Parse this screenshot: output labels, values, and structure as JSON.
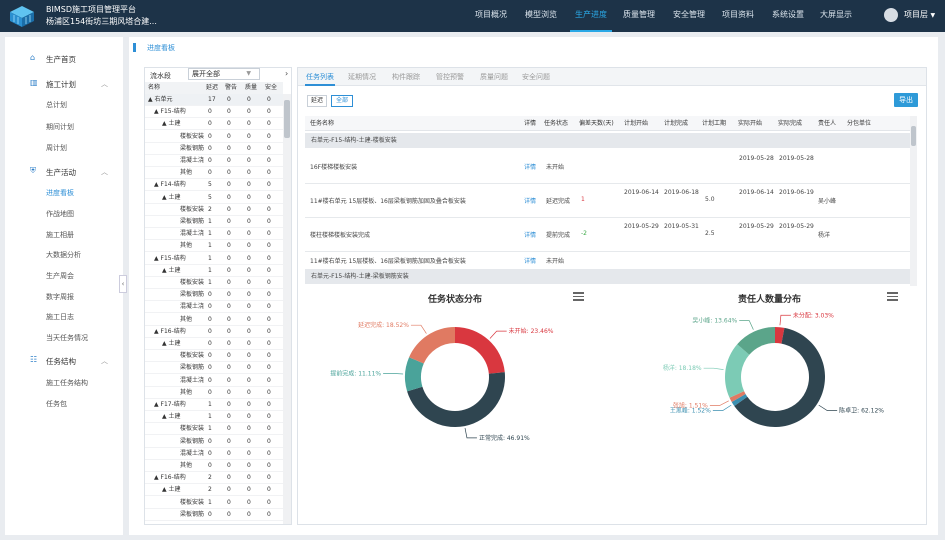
{
  "header": {
    "brand_line1": "BIMSD施工项目管理平台",
    "brand_line2": "杨浦区154街坊三期风塔合建...",
    "nav": [
      "项目概况",
      "模型浏览",
      "生产进度",
      "质量管理",
      "安全管理",
      "项目资料",
      "系统设置",
      "大屏显示"
    ],
    "active_nav": "生产进度",
    "user": "项目层"
  },
  "sidebar": {
    "home": "生产首页",
    "plan": {
      "label": "施工计划",
      "items": [
        "总计划",
        "期间计划",
        "周计划"
      ]
    },
    "activity": {
      "label": "生产活动",
      "items": [
        "进度看板",
        "作战地图",
        "施工相册",
        "大数据分析",
        "生产周会",
        "数字周报",
        "施工日志",
        "当天任务情况"
      ]
    },
    "structure": {
      "label": "任务结构",
      "items": [
        "施工任务结构",
        "任务包"
      ]
    },
    "active_item": "进度看板"
  },
  "breadcrumb": "进度看板",
  "tree_panel": {
    "filter_label": "流水段",
    "filter_value": "展开全部",
    "columns": [
      "名称",
      "延迟",
      "警告",
      "质量",
      "安全"
    ],
    "rows": [
      {
        "name": "▲ 右单元",
        "v": [
          "17",
          "0",
          "0",
          "0"
        ]
      },
      {
        "name": "▲ F15-结构",
        "v": [
          "0",
          "0",
          "0",
          "0"
        ]
      },
      {
        "name": "▲ 土建",
        "v": [
          "0",
          "0",
          "0",
          "0"
        ]
      },
      {
        "name": "楼板安装",
        "v": [
          "0",
          "0",
          "0",
          "0"
        ]
      },
      {
        "name": "梁板钢筋",
        "v": [
          "0",
          "0",
          "0",
          "0"
        ]
      },
      {
        "name": "混凝土浇",
        "v": [
          "0",
          "0",
          "0",
          "0"
        ]
      },
      {
        "name": "其他",
        "v": [
          "0",
          "0",
          "0",
          "0"
        ]
      },
      {
        "name": "▲ F14-结构",
        "v": [
          "5",
          "0",
          "0",
          "0"
        ]
      },
      {
        "name": "▲ 土建",
        "v": [
          "5",
          "0",
          "0",
          "0"
        ]
      },
      {
        "name": "楼板安装",
        "v": [
          "2",
          "0",
          "0",
          "0"
        ]
      },
      {
        "name": "梁板钢筋",
        "v": [
          "1",
          "0",
          "0",
          "0"
        ]
      },
      {
        "name": "混凝土浇",
        "v": [
          "1",
          "0",
          "0",
          "0"
        ]
      },
      {
        "name": "其他",
        "v": [
          "1",
          "0",
          "0",
          "0"
        ]
      },
      {
        "name": "▲ F15-结构",
        "v": [
          "1",
          "0",
          "0",
          "0"
        ]
      },
      {
        "name": "▲ 土建",
        "v": [
          "1",
          "0",
          "0",
          "0"
        ]
      },
      {
        "name": "楼板安装",
        "v": [
          "1",
          "0",
          "0",
          "0"
        ]
      },
      {
        "name": "梁板钢筋",
        "v": [
          "0",
          "0",
          "0",
          "0"
        ]
      },
      {
        "name": "混凝土浇",
        "v": [
          "0",
          "0",
          "0",
          "0"
        ]
      },
      {
        "name": "其他",
        "v": [
          "0",
          "0",
          "0",
          "0"
        ]
      },
      {
        "name": "▲ F16-结构",
        "v": [
          "0",
          "0",
          "0",
          "0"
        ]
      },
      {
        "name": "▲ 土建",
        "v": [
          "0",
          "0",
          "0",
          "0"
        ]
      },
      {
        "name": "楼板安装",
        "v": [
          "0",
          "0",
          "0",
          "0"
        ]
      },
      {
        "name": "梁板钢筋",
        "v": [
          "0",
          "0",
          "0",
          "0"
        ]
      },
      {
        "name": "混凝土浇",
        "v": [
          "0",
          "0",
          "0",
          "0"
        ]
      },
      {
        "name": "其他",
        "v": [
          "0",
          "0",
          "0",
          "0"
        ]
      },
      {
        "name": "▲ F17-结构",
        "v": [
          "1",
          "0",
          "0",
          "0"
        ]
      },
      {
        "name": "▲ 土建",
        "v": [
          "1",
          "0",
          "0",
          "0"
        ]
      },
      {
        "name": "楼板安装",
        "v": [
          "1",
          "0",
          "0",
          "0"
        ]
      },
      {
        "name": "梁板钢筋",
        "v": [
          "0",
          "0",
          "0",
          "0"
        ]
      },
      {
        "name": "混凝土浇",
        "v": [
          "0",
          "0",
          "0",
          "0"
        ]
      },
      {
        "name": "其他",
        "v": [
          "0",
          "0",
          "0",
          "0"
        ]
      },
      {
        "name": "▲ F16-结构",
        "v": [
          "2",
          "0",
          "0",
          "0"
        ]
      },
      {
        "name": "▲ 土建",
        "v": [
          "2",
          "0",
          "0",
          "0"
        ]
      },
      {
        "name": "楼板安装",
        "v": [
          "1",
          "0",
          "0",
          "0"
        ]
      },
      {
        "name": "梁板钢筋",
        "v": [
          "0",
          "0",
          "0",
          "0"
        ]
      }
    ]
  },
  "tabs": [
    "任务列表",
    "延期情况",
    "构件跟踪",
    "管控预警",
    "质量问题",
    "安全问题"
  ],
  "active_tab": "任务列表",
  "filter_buttons": [
    "延迟",
    "全部"
  ],
  "active_filter": "全部",
  "export_label": "导出",
  "table": {
    "columns": [
      "任务名称",
      "详情",
      "任务状态",
      "偏差天数(天)",
      "计划开始",
      "计划完成",
      "计划工期",
      "实际开始",
      "实际完成",
      "责任人",
      "分包单位"
    ],
    "group1": "右单元-F15-结构-土建-楼板安装",
    "rows": [
      {
        "name": "16F楼梯楼板安装",
        "detail": "详情",
        "status": "未开始",
        "dev": "",
        "ps": "",
        "pe": "",
        "pd": "",
        "as": "2019-05-28",
        "ae": "2019-05-28",
        "owner": ""
      },
      {
        "name": "11#楼右单元 15层楼板、16层梁板钢筋加固及叠合板安装",
        "detail": "详情",
        "status": "延迟完成",
        "dev": "1",
        "ps": "2019-06-14",
        "pe": "2019-06-18",
        "pd": "5.0",
        "as": "2019-06-14",
        "ae": "2019-06-19",
        "owner": "吴小峰"
      },
      {
        "name": "楼柱楼梯楼板安装完成",
        "detail": "详情",
        "status": "提前完成",
        "dev": "-2",
        "ps": "2019-05-29",
        "pe": "2019-05-31",
        "pd": "2.5",
        "as": "2019-05-29",
        "ae": "2019-05-29",
        "owner": "杨洋"
      },
      {
        "name": "11#楼右单元 15层楼板、16层梁板钢筋加固及叠合板安装",
        "detail": "详情",
        "status": "未开始",
        "dev": "",
        "ps": "",
        "pe": "",
        "pd": "",
        "as": "",
        "ae": "",
        "owner": ""
      }
    ],
    "group2": "右单元-F15-结构-土建-梁板钢筋安装"
  },
  "chart_data": [
    {
      "type": "pie",
      "title": "任务状态分布",
      "slices": [
        {
          "label": "未开始",
          "value": 23.46,
          "color": "#d9373f"
        },
        {
          "label": "正常完成",
          "value": 46.91,
          "color": "#2f4550"
        },
        {
          "label": "提前完成",
          "value": 11.11,
          "color": "#4aa39a"
        },
        {
          "label": "延迟完成",
          "value": 18.52,
          "color": "#e07a62"
        }
      ],
      "slice_text": [
        "未开始: 23.46%",
        "正常完成: 46.91%",
        "提前完成: 11.11%",
        "延迟完成: 18.52%"
      ]
    },
    {
      "type": "pie",
      "title": "责任人数量分布",
      "slices": [
        {
          "label": "未分配",
          "value": 3.03,
          "color": "#d9373f"
        },
        {
          "label": "陈卓卫",
          "value": 62.12,
          "color": "#2f4550"
        },
        {
          "label": "王黑峰",
          "value": 1.52,
          "color": "#3b8fb0"
        },
        {
          "label": "张旭",
          "value": 1.51,
          "color": "#e07a62"
        },
        {
          "label": "杨洋",
          "value": 18.18,
          "color": "#7ccbb5"
        },
        {
          "label": "吴小峰",
          "value": 13.64,
          "color": "#5ba58a"
        }
      ],
      "slice_text": [
        "未分配: 3.03%",
        "陈卓卫: 62.12%",
        "王黑峰: 1.52%",
        "张旭: 1.51%",
        "杨洋: 18.18%",
        "吴小峰: 13.64%"
      ]
    }
  ]
}
